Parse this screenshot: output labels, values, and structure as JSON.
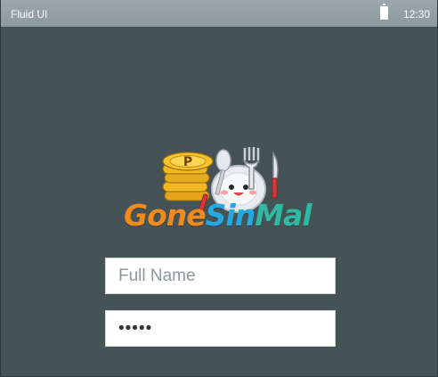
{
  "statusbar": {
    "app_name": "Fluid UI",
    "battery_icon": "battery-full-icon",
    "time": "12:30"
  },
  "logo": {
    "brand_part1": "Gone",
    "brand_part2": "Sin",
    "brand_part3": "Mal",
    "coin_symbol": "P",
    "colors": {
      "orange": "#f08a1c",
      "blue": "#26a9e0",
      "teal": "#2fb9a0",
      "coin_gold": "#f7c52b",
      "background": "#455256"
    }
  },
  "form": {
    "name_placeholder": "Full Name",
    "password_value": "12345"
  }
}
